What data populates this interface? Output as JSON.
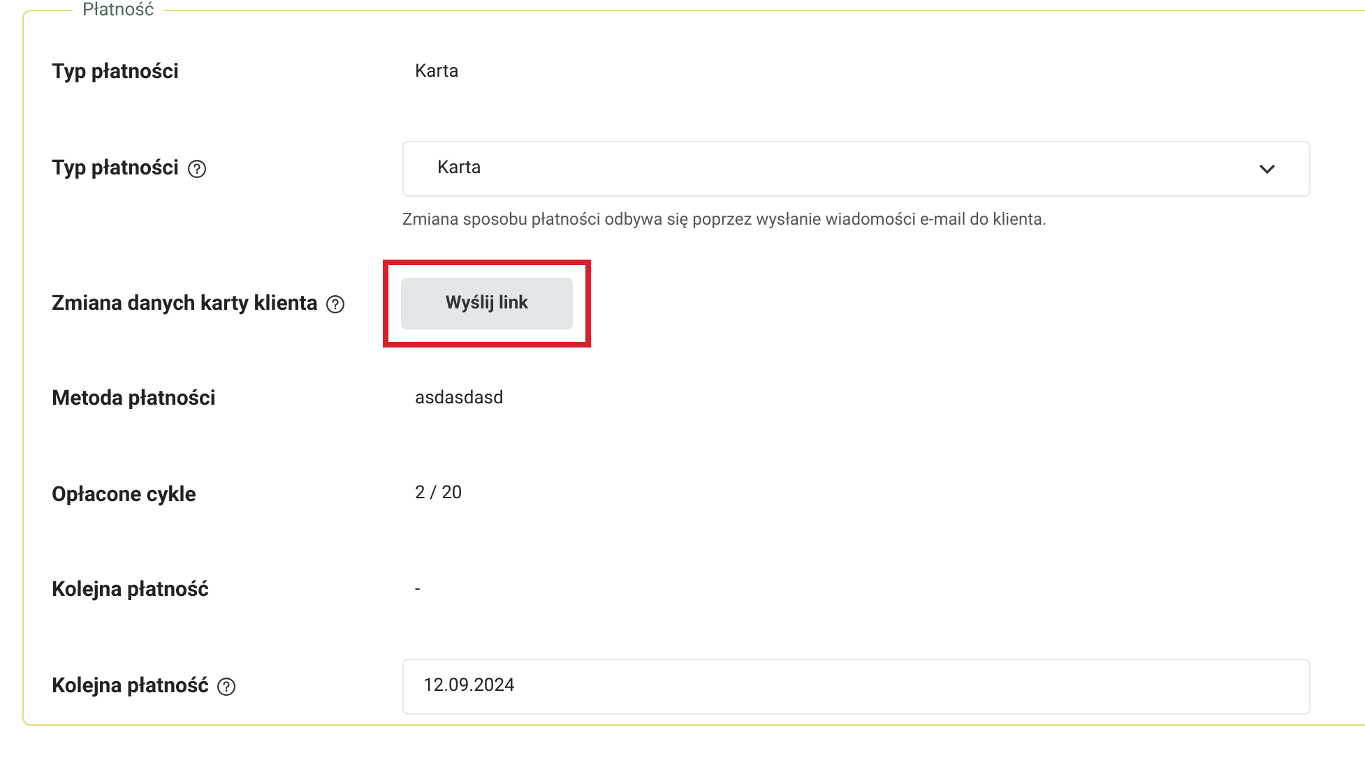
{
  "section": {
    "title": "Płatność"
  },
  "rows": [
    {
      "kind": "text",
      "label": "Typ płatności",
      "help": false,
      "value": "Karta"
    },
    {
      "kind": "select",
      "label": "Typ płatności",
      "help": true,
      "value": "Karta",
      "note": "Zmiana sposobu płatności odbywa się poprzez wysłanie wiadomości e-mail do klienta."
    },
    {
      "kind": "button",
      "label": "Zmiana danych karty klienta",
      "help": true,
      "value": "Wyślij link",
      "highlighted": true
    },
    {
      "kind": "text",
      "label": "Metoda płatności",
      "help": false,
      "value": "asdasdasd"
    },
    {
      "kind": "text",
      "label": "Opłacone cykle",
      "help": false,
      "value": "2 / 20"
    },
    {
      "kind": "text",
      "label": "Kolejna płatność",
      "help": false,
      "value": "-"
    },
    {
      "kind": "input",
      "label": "Kolejna płatność",
      "help": true,
      "value": "12.09.2024"
    }
  ]
}
